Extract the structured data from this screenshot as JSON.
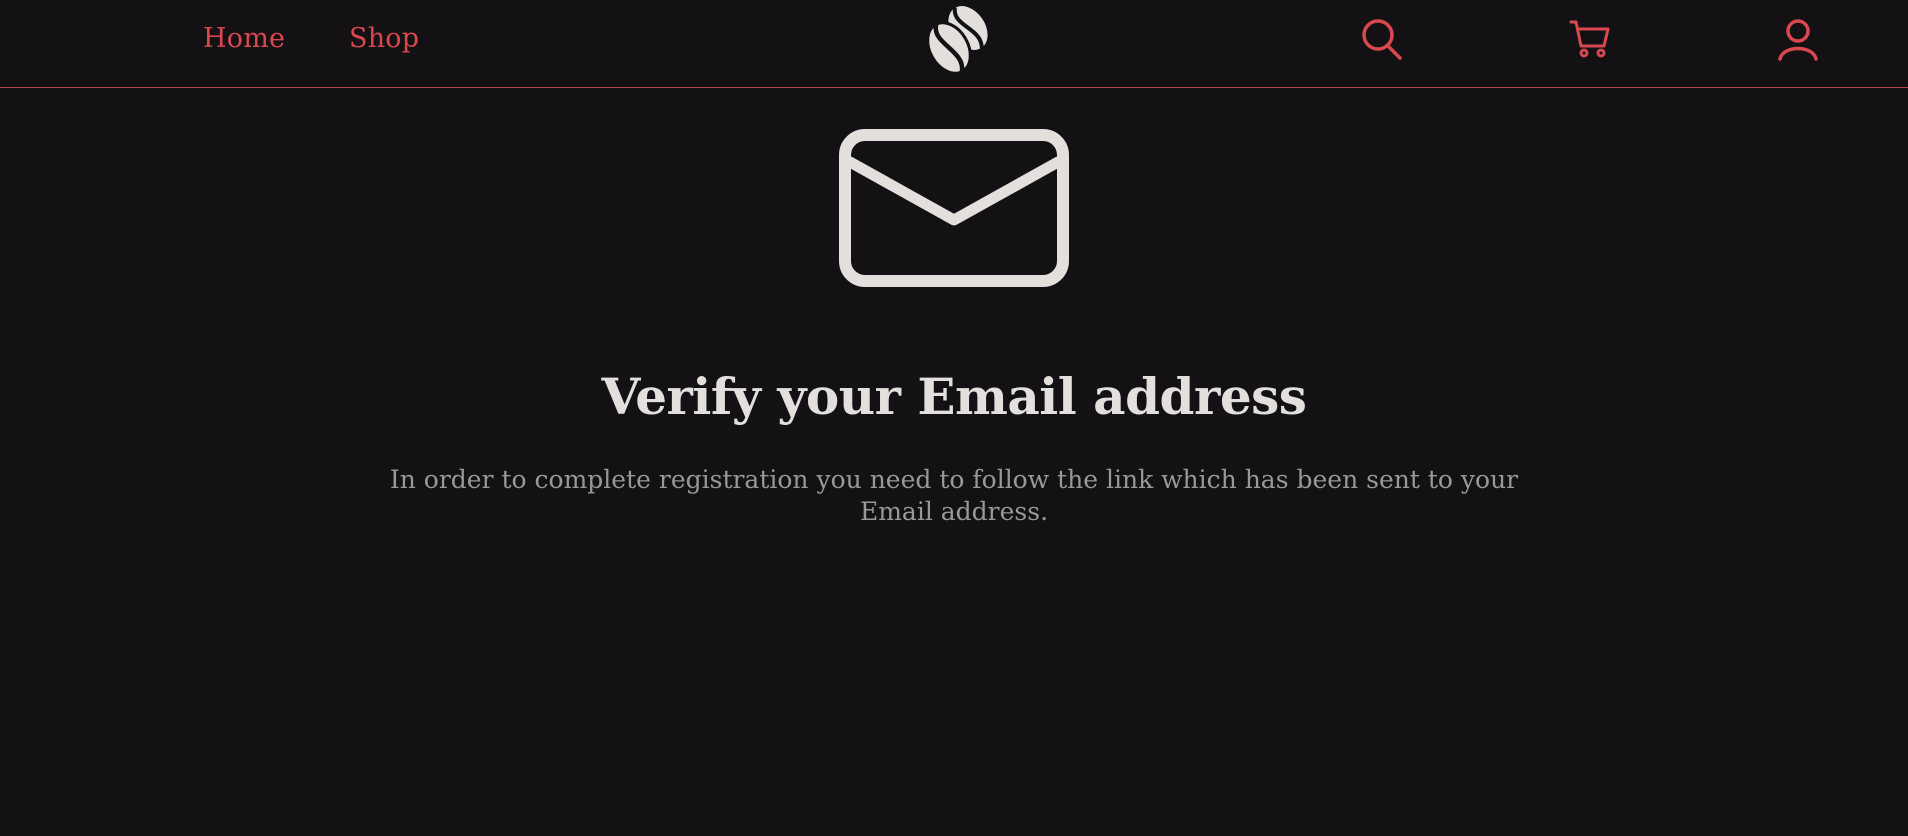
{
  "nav": {
    "home_label": "Home",
    "shop_label": "Shop"
  },
  "header": {
    "logo_icon": "coffee-beans-icon",
    "search_icon": "search-icon",
    "cart_icon": "cart-icon",
    "account_icon": "user-icon"
  },
  "main": {
    "icon": "envelope-icon",
    "title": "Verify your Email address",
    "message": "In order to complete registration you need to follow the link which has been sent to your Email address."
  },
  "colors": {
    "background": "#131114",
    "accent": "#d9484f",
    "heading": "#e2dfdd",
    "body_text": "#9b9797"
  }
}
